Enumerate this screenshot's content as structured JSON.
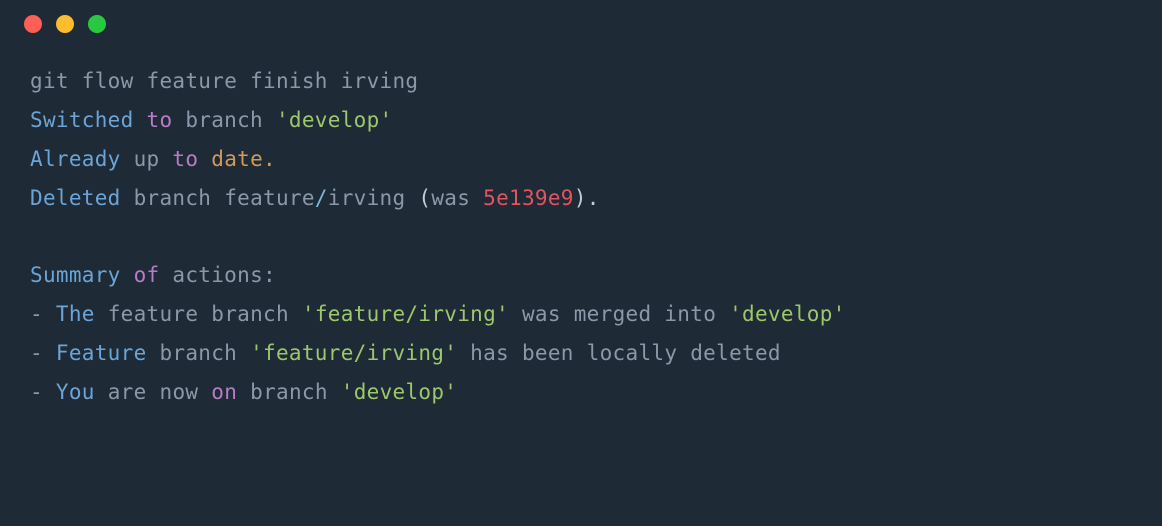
{
  "colors": {
    "red_dot": "#ff5f57",
    "yellow_dot": "#febc2e",
    "green_dot": "#28c840",
    "background": "#1e2a35"
  },
  "l1": {
    "t1": "git",
    "t2": "flow",
    "t3": "feature",
    "t4": "finish",
    "t5": "irving"
  },
  "l2": {
    "t1": "Switched",
    "t2": "to",
    "t3": "branch",
    "t4": "'develop'"
  },
  "l3": {
    "t1": "Already",
    "t2": "up",
    "t3": "to",
    "t4": "date."
  },
  "l4": {
    "t1": "Deleted",
    "t2": "branch",
    "t3": "feature",
    "t4": "/",
    "t5": "irving",
    "t6": "(",
    "t7": "was",
    "t8": "5e139e9",
    "t9": ")",
    "t10": "."
  },
  "l5": {
    "t1": "Summary",
    "t2": "of",
    "t3": "actions:"
  },
  "l6": {
    "t1": "-",
    "t2": "The",
    "t3": "feature",
    "t4": "branch",
    "t5": "'feature/irving'",
    "t6": "was",
    "t7": "merged",
    "t8": "into",
    "t9": "'develop'"
  },
  "l7": {
    "t1": "-",
    "t2": "Feature",
    "t3": "branch",
    "t4": "'feature/irving'",
    "t5": "has",
    "t6": "been",
    "t7": "locally",
    "t8": "deleted"
  },
  "l8": {
    "t1": "-",
    "t2": "You",
    "t3": "are",
    "t4": "now",
    "t5": "on",
    "t6": "branch",
    "t7": "'develop'"
  }
}
